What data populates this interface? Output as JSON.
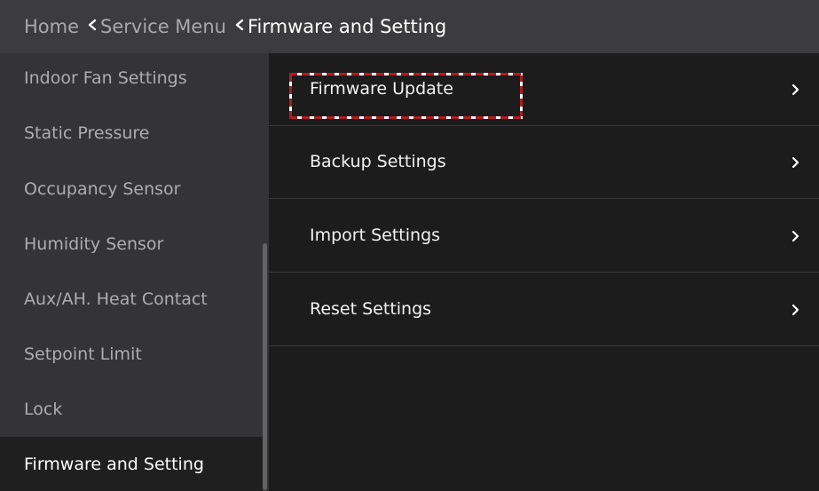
{
  "breadcrumb": {
    "home": "Home",
    "service_menu": "Service Menu",
    "current": "Firmware and Setting"
  },
  "sidebar": {
    "items": [
      {
        "label": "Indoor Fan Settings",
        "active": false
      },
      {
        "label": "Static Pressure",
        "active": false
      },
      {
        "label": "Occupancy Sensor",
        "active": false
      },
      {
        "label": "Humidity Sensor",
        "active": false
      },
      {
        "label": "Aux/AH. Heat Contact",
        "active": false
      },
      {
        "label": "Setpoint Limit",
        "active": false
      },
      {
        "label": "Lock",
        "active": false
      },
      {
        "label": "Firmware and Setting",
        "active": true
      }
    ]
  },
  "main": {
    "items": [
      {
        "label": "Firmware Update",
        "highlighted": true
      },
      {
        "label": "Backup Settings",
        "highlighted": false
      },
      {
        "label": "Import Settings",
        "highlighted": false
      },
      {
        "label": "Reset Settings",
        "highlighted": false
      }
    ]
  },
  "colors": {
    "header_bg": "#3c3c3e",
    "sidebar_bg": "#343436",
    "main_bg": "#1c1c1c",
    "highlight_dash": "#b01c24"
  },
  "icons": {
    "breadcrumb_separator": "chevron-left-icon",
    "row_arrow": "chevron-right-icon"
  }
}
